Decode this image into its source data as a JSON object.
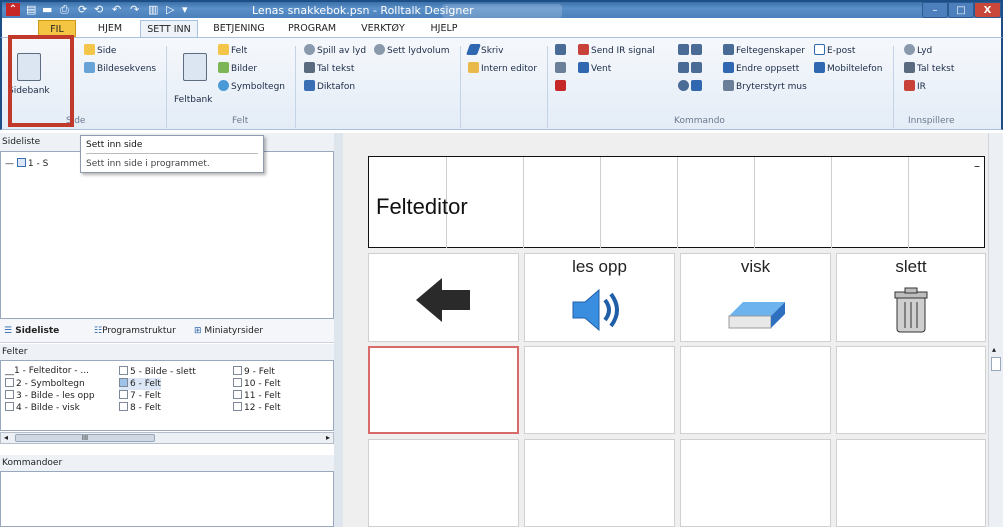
{
  "titlebar": {
    "app_icon": "rolltalk-logo-icon",
    "title": "Lenas snakkebok.psn - Rolltalk Designer",
    "min": "–",
    "max": "□",
    "close": "X"
  },
  "menu": [
    "FIL",
    "HJEM",
    "SETT INN",
    "BETJENING",
    "PROGRAM",
    "VERKTØY",
    "HJELP"
  ],
  "ribbon": {
    "side": {
      "sidebank": "Sidebank",
      "side": "Side",
      "bildesekvens": "Bildesekvens",
      "label": "Side"
    },
    "felt": {
      "feltbank": "Feltbank",
      "felt": "Felt",
      "bilder": "Bilder",
      "symboltegn": "Symboltegn",
      "label": "Felt"
    },
    "lyd": {
      "spill_av_lyd": "Spill av lyd",
      "sett_lydvolum": "Sett lydvolum",
      "tal_tekst": "Tal tekst",
      "diktafon": "Diktafon"
    },
    "skriv": {
      "skriv": "Skriv",
      "intern_editor": "Intern editor"
    },
    "kommando": {
      "send_ir": "Send IR signal",
      "vent": "Vent",
      "feltegenskaper": "Feltegenskaper",
      "epost": "E-post",
      "endre_oppsett": "Endre oppsett",
      "mobiltelefon": "Mobiltelefon",
      "bryterstyrt_mus": "Bryterstyrt mus",
      "label": "Kommando"
    },
    "innspillere": {
      "lyd": "Lyd",
      "tal_tekst": "Tal tekst",
      "ir": "IR",
      "label": "Innspillere"
    }
  },
  "tooltip": {
    "title": "Sett inn side",
    "desc": "Sett inn side i programmet."
  },
  "sideliste": {
    "header": "Sideliste",
    "item": "1 - S"
  },
  "tabs": [
    "Sideliste",
    "Programstruktur",
    "Miniatyrsider"
  ],
  "felter": {
    "header": "Felter",
    "items": [
      "1 - Felteditor - ...",
      "2 - Symboltegn",
      "3 - Bilde - les opp",
      "4 - Bilde - visk",
      "5 - Bilde - slett",
      "6 - Felt",
      "7 - Felt",
      "8 - Felt",
      "9 - Felt",
      "10 - Felt",
      "11 - Felt",
      "12 - Felt"
    ],
    "scroll_mark": "III"
  },
  "kommandoer": {
    "header": "Kommandoer"
  },
  "editor": {
    "felteditor": "Felteditor",
    "cells": [
      "les opp",
      "visk",
      "slett"
    ],
    "close": "–"
  }
}
